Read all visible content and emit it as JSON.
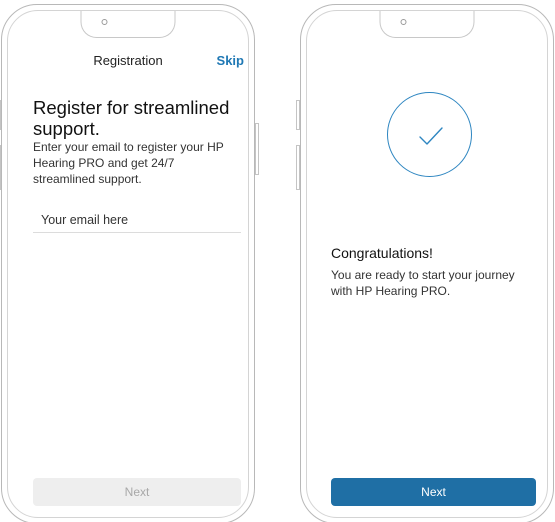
{
  "registration_screen": {
    "header_title": "Registration",
    "skip_label": "Skip",
    "heading": "Register for streamlined support.",
    "description": "Enter your email to register your HP Hearing PRO and get 24/7 streamlined support.",
    "email_placeholder": "Your email here",
    "next_label": "Next",
    "next_enabled": false
  },
  "confirmation_screen": {
    "icon": "checkmark-icon",
    "heading": "Congratulations!",
    "description": "You are ready to start your journey with HP Hearing PRO.",
    "next_label": "Next",
    "next_enabled": true
  },
  "colors": {
    "accent": "#1f78b4",
    "button_primary": "#1f6fa5",
    "button_disabled_bg": "#eeeeee",
    "button_disabled_text": "#a8a8a8",
    "frame": "#b8b8b8"
  }
}
